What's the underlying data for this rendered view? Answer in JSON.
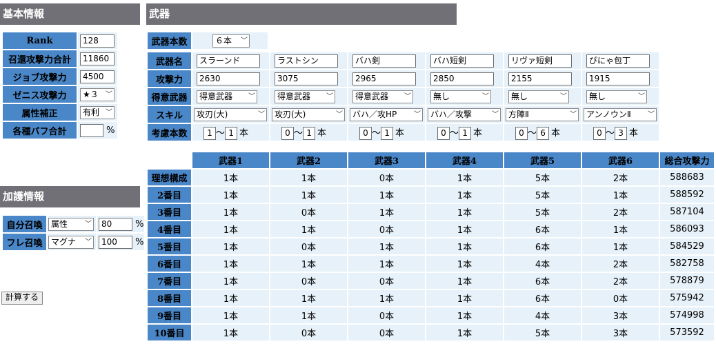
{
  "basic": {
    "title": "基本情報",
    "rows": [
      {
        "label": "Rank",
        "value": "128"
      },
      {
        "label": "召還攻撃力合計",
        "value": "11860"
      },
      {
        "label": "ジョブ攻撃力",
        "value": "4500"
      },
      {
        "label": "ゼニス攻撃力",
        "select": "★３"
      },
      {
        "label": "属性補正",
        "select": "有利"
      },
      {
        "label": "各種バフ合計",
        "value": "",
        "unit": "%"
      }
    ]
  },
  "protect": {
    "title": "加護情報",
    "rows": [
      {
        "label": "自分召喚",
        "select": "属性",
        "value": "80",
        "unit": "%"
      },
      {
        "label": "フレ召喚",
        "select": "マグナ",
        "value": "100",
        "unit": "%"
      }
    ]
  },
  "calc_button": "計算する",
  "weapons": {
    "title": "武器",
    "count_label": "武器本数",
    "count_value": "６本",
    "name_label": "武器名",
    "attack_label": "攻撃力",
    "special_label": "得意武器",
    "skill_label": "スキル",
    "consider_label": "考慮本数",
    "range_sep": "～",
    "range_unit": "本",
    "items": [
      {
        "name": "スラーンド",
        "attack": "2630",
        "special": "得意武器",
        "skill": "攻刃(大)",
        "min": "1",
        "max": "1"
      },
      {
        "name": "ラストシン",
        "attack": "3075",
        "special": "得意武器",
        "skill": "攻刃(大)",
        "min": "0",
        "max": "1"
      },
      {
        "name": "バハ剣",
        "attack": "2965",
        "special": "得意武器",
        "skill": "バハ／攻HP",
        "min": "0",
        "max": "1"
      },
      {
        "name": "バハ短剣",
        "attack": "2850",
        "special": "無し",
        "skill": "バハ／攻撃",
        "min": "0",
        "max": "1"
      },
      {
        "name": "リヴァ短剣",
        "attack": "2155",
        "special": "無し",
        "skill": "方陣Ⅱ",
        "min": "0",
        "max": "6"
      },
      {
        "name": "ぴにゃ包丁",
        "attack": "1915",
        "special": "無し",
        "skill": "アンノウンⅡ",
        "min": "0",
        "max": "3"
      }
    ]
  },
  "results": {
    "headers": [
      "武器1",
      "武器2",
      "武器3",
      "武器4",
      "武器5",
      "武器6",
      "総合攻撃力"
    ],
    "rows": [
      {
        "label": "理想構成",
        "cells": [
          "1本",
          "1本",
          "0本",
          "1本",
          "5本",
          "2本",
          "588683"
        ]
      },
      {
        "label": "2番目",
        "cells": [
          "1本",
          "1本",
          "1本",
          "1本",
          "5本",
          "1本",
          "588592"
        ]
      },
      {
        "label": "3番目",
        "cells": [
          "1本",
          "0本",
          "1本",
          "1本",
          "5本",
          "2本",
          "587104"
        ]
      },
      {
        "label": "4番目",
        "cells": [
          "1本",
          "1本",
          "0本",
          "1本",
          "6本",
          "1本",
          "586093"
        ]
      },
      {
        "label": "5番目",
        "cells": [
          "1本",
          "0本",
          "1本",
          "1本",
          "6本",
          "1本",
          "584529"
        ]
      },
      {
        "label": "6番目",
        "cells": [
          "1本",
          "1本",
          "1本",
          "1本",
          "4本",
          "2本",
          "582758"
        ]
      },
      {
        "label": "7番目",
        "cells": [
          "1本",
          "0本",
          "0本",
          "1本",
          "6本",
          "2本",
          "578879"
        ]
      },
      {
        "label": "8番目",
        "cells": [
          "1本",
          "1本",
          "1本",
          "1本",
          "6本",
          "0本",
          "575942"
        ]
      },
      {
        "label": "9番目",
        "cells": [
          "1本",
          "1本",
          "0本",
          "1本",
          "4本",
          "3本",
          "574998"
        ]
      },
      {
        "label": "10番目",
        "cells": [
          "1本",
          "0本",
          "0本",
          "1本",
          "5本",
          "3本",
          "573592"
        ]
      }
    ]
  }
}
